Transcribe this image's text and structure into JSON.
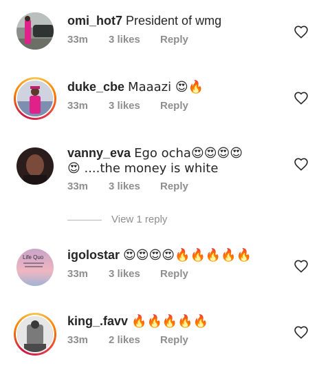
{
  "comments": [
    {
      "username": "omi_hot7",
      "text": "President of wmg",
      "time": "33m",
      "likes": "3 likes",
      "reply": "Reply"
    },
    {
      "username": "duke_cbe",
      "text": "Maaazi 😍🔥",
      "time": "33m",
      "likes": "3 likes",
      "reply": "Reply"
    },
    {
      "username": "vanny_eva",
      "text": "Ego ocha😍😍😍😍",
      "text2": "😍 ....the money is white",
      "time": "33m",
      "likes": "3 likes",
      "reply": "Reply"
    },
    {
      "username": "igolostar",
      "text": "😍😍😍😍🔥🔥🔥🔥🔥",
      "time": "33m",
      "likes": "3 likes",
      "reply": "Reply"
    },
    {
      "username": "king_.favv",
      "text": "🔥🔥🔥🔥🔥",
      "time": "33m",
      "likes": "2 likes",
      "reply": "Reply"
    }
  ],
  "view_replies": "View 1 reply",
  "avatar_text": "Life Quo",
  "icons": {
    "like": "heart-outline-icon"
  }
}
